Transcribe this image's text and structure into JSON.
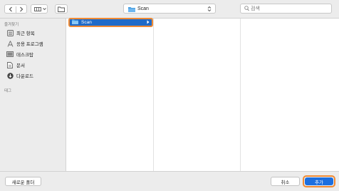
{
  "toolbar": {
    "location": "Scan",
    "search_placeholder": "검색"
  },
  "sidebar": {
    "favorites_label": "즐겨찾기",
    "items": [
      {
        "label": "최근 항목",
        "icon": "recent-items-icon"
      },
      {
        "label": "응용 프로그램",
        "icon": "applications-icon"
      },
      {
        "label": "데스크탑",
        "icon": "desktop-icon"
      },
      {
        "label": "문서",
        "icon": "documents-icon"
      },
      {
        "label": "다운로드",
        "icon": "downloads-icon"
      }
    ],
    "tags_label": "태그"
  },
  "browser": {
    "columns": [
      {
        "items": [
          {
            "label": "Scan",
            "selected": true
          }
        ]
      }
    ]
  },
  "footer": {
    "new_folder_label": "새로운 폴더",
    "cancel_label": "취소",
    "add_label": "추가"
  },
  "colors": {
    "selection": "#1f6ac8",
    "highlight_outline": "#ef8a34",
    "primary_button": "#1c6fe0"
  }
}
